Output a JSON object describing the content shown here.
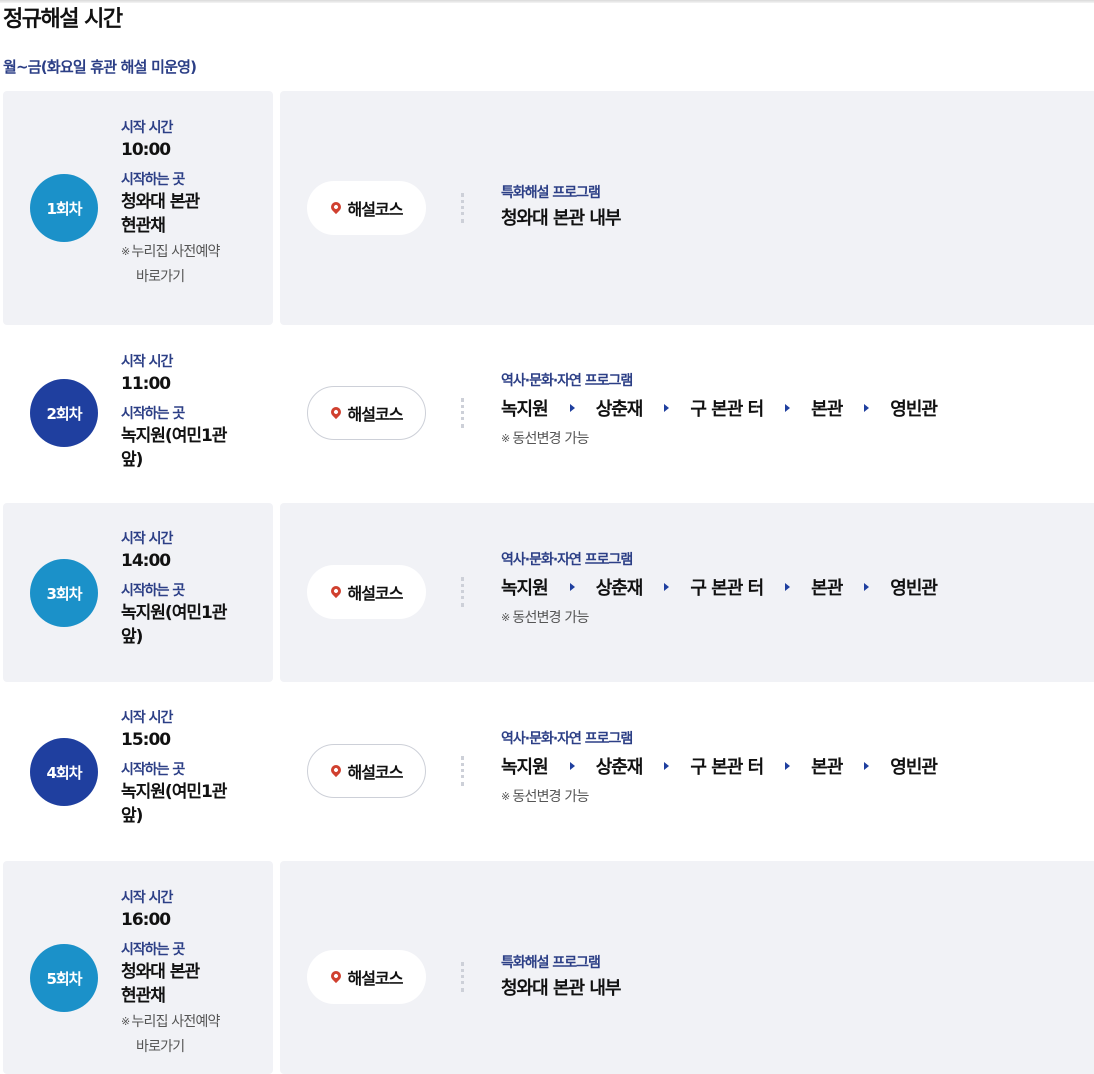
{
  "page": {
    "title": "정규해설 시간",
    "subtitle": "월~금(화요일 휴관 해설 미운영)"
  },
  "labels": {
    "start_time": "시작 시간",
    "start_place": "시작하는 곳",
    "course_button": "해설코스",
    "reservation_mark": "※",
    "reservation_note_1": "누리집 사전예약",
    "reservation_note_2": "바로가기",
    "route_note_mark": "※",
    "route_note": "동선변경 가능"
  },
  "sessions": [
    {
      "badge": "1회차",
      "time": "10:00",
      "place_line1": "청와대 본관",
      "place_line2": "현관채",
      "program_category": "특화해설 프로그램",
      "program_title": "청와대 본관 내부"
    },
    {
      "badge": "2회차",
      "time": "11:00",
      "place_line1": "녹지원(여민1관",
      "place_line2": "앞)",
      "program_category": "역사·문화·자연 프로그램",
      "route": [
        "녹지원",
        "상춘재",
        "구 본관 터",
        "본관",
        "영빈관"
      ]
    },
    {
      "badge": "3회차",
      "time": "14:00",
      "place_line1": "녹지원(여민1관",
      "place_line2": "앞)",
      "program_category": "역사·문화·자연 프로그램",
      "route": [
        "녹지원",
        "상춘재",
        "구 본관 터",
        "본관",
        "영빈관"
      ]
    },
    {
      "badge": "4회차",
      "time": "15:00",
      "place_line1": "녹지원(여민1관",
      "place_line2": "앞)",
      "program_category": "역사·문화·자연 프로그램",
      "route": [
        "녹지원",
        "상춘재",
        "구 본관 터",
        "본관",
        "영빈관"
      ]
    },
    {
      "badge": "5회차",
      "time": "16:00",
      "place_line1": "청와대 본관",
      "place_line2": "현관채",
      "program_category": "특화해설 프로그램",
      "program_title": "청와대 본관 내부"
    }
  ],
  "colors": {
    "special_badge": "#1b91c9",
    "history_badge": "#1f3f9f",
    "label_navy": "#2c3f86",
    "row_background": "#f1f2f6",
    "pin_red": "#d0402f"
  },
  "icons": {
    "course_pin": "map-pin-icon",
    "route_separator": "triangle-right-icon"
  }
}
